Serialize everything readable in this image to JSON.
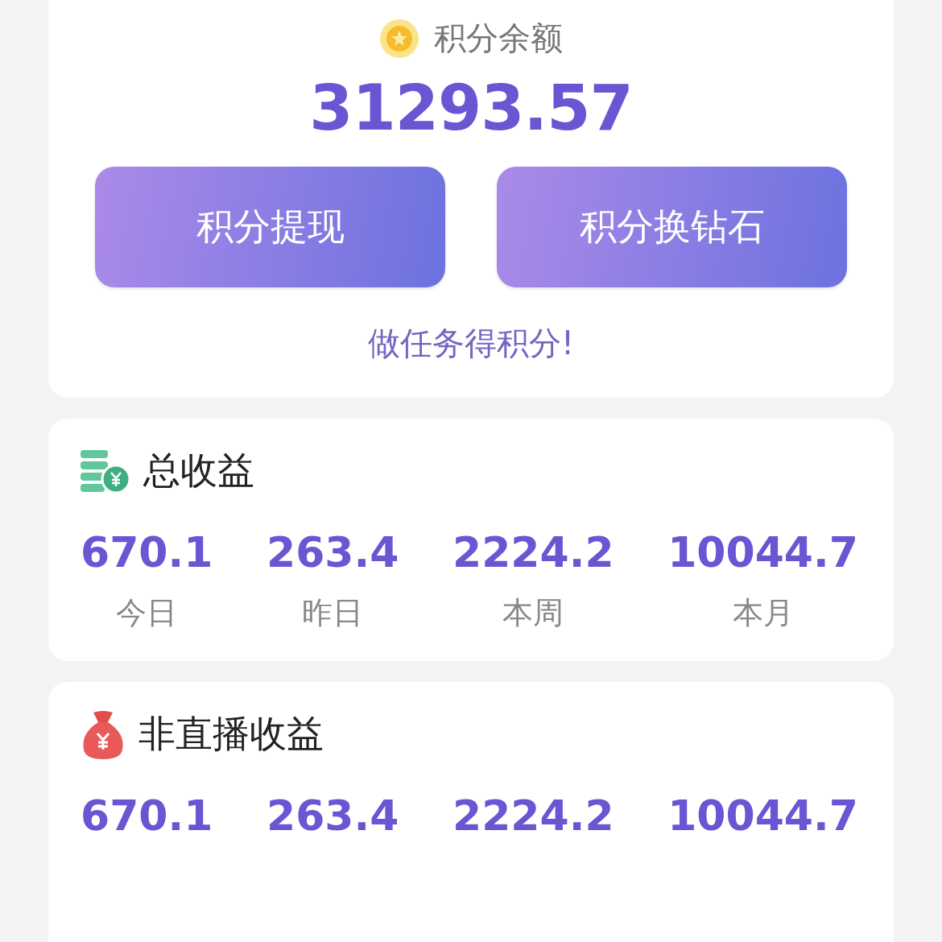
{
  "balance": {
    "label": "积分余额",
    "amount": "31293.57"
  },
  "actions": [
    {
      "label": "积分提现"
    },
    {
      "label": "积分换钻石"
    }
  ],
  "task_link": "做任务得积分!",
  "sections": [
    {
      "title": "总收益",
      "kind": "coins",
      "stats": [
        {
          "value": "670.1",
          "label": "今日"
        },
        {
          "value": "263.4",
          "label": "昨日"
        },
        {
          "value": "2224.2",
          "label": "本周"
        },
        {
          "value": "10044.7",
          "label": "本月"
        }
      ]
    },
    {
      "title": "非直播收益",
      "kind": "moneybag",
      "stats": [
        {
          "value": "670.1"
        },
        {
          "value": "263.4"
        },
        {
          "value": "2224.2"
        },
        {
          "value": "10044.7"
        }
      ]
    }
  ]
}
